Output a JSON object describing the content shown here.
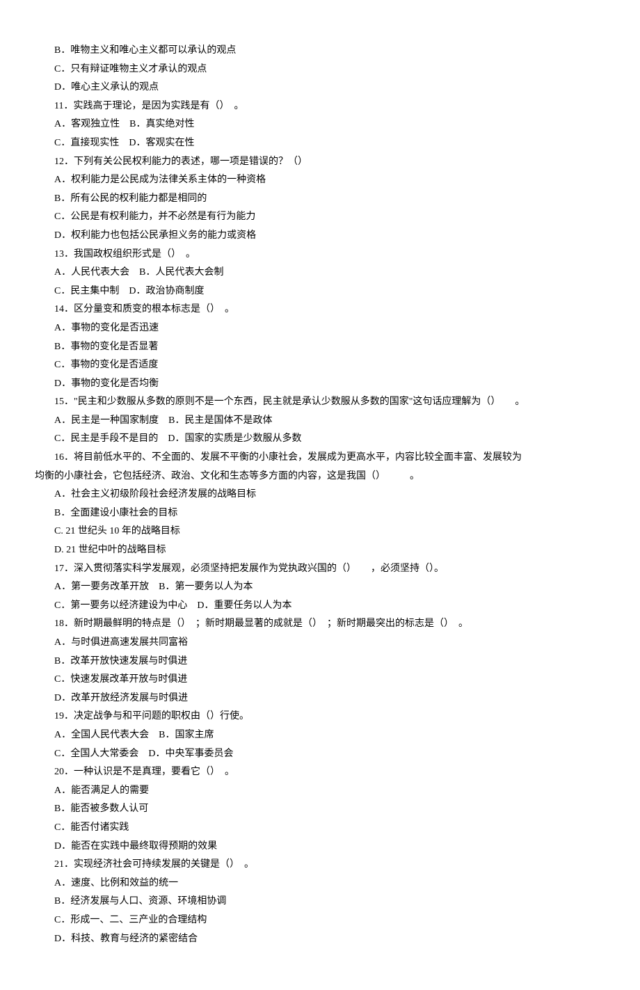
{
  "lines": [
    "B．唯物主义和唯心主义都可以承认的观点",
    "C．只有辩证唯物主义才承认的观点",
    "D．唯心主义承认的观点",
    "11．实践高于理论，是因为实践是有（）　。",
    "A．客观独立性　B．真实绝对性",
    "C．直接现实性　D．客观实在性",
    "12．下列有关公民权利能力的表述，哪一项是错误的？（）",
    "A．权利能力是公民成为法律关系主体的一种资格",
    "B．所有公民的权利能力都是相同的",
    "C．公民是有权利能力，并不必然是有行为能力",
    "D．权利能力也包括公民承担义务的能力或资格",
    "13．我国政权组织形式是（）　。",
    "A．人民代表大会　B．人民代表大会制",
    "C．民主集中制　D．政治协商制度",
    "14．区分量变和质变的根本标志是（）　。",
    "A．事物的变化是否迅速",
    "B．事物的变化是否显著",
    "C．事物的变化是否适度",
    "D．事物的变化是否均衡",
    "15．\"民主和少数服从多数的原则不是一个东西，民主就是承认少数服从多数的国家\"这句话应理解为（）　　。",
    "A．民主是一种国家制度　B．民主是国体不是政体",
    "C．民主是手段不是目的　D．国家的实质是少数服从多数"
  ],
  "q16_line1": "16．将目前低水平的、不全面的、发展不平衡的小康社会，发展成为更高水平，内容比较全面丰富、发展较为",
  "q16_line2": "均衡的小康社会，它包括经济、政治、文化和生态等多方面的内容，这是我国（）　　　。",
  "lines2": [
    "A．社会主义初级阶段社会经济发展的战略目标",
    "B．全面建设小康社会的目标",
    "C. 21 世纪头 10 年的战略目标",
    "D. 21 世纪中叶的战略目标",
    "17．深入贯彻落实科学发展观，必须坚持把发展作为党执政兴国的（）　　，必须坚持（）。",
    "A．第一要务改革开放　B．第一要务以人为本",
    "C．第一要务以经济建设为中心　D．重要任务以人为本",
    "18．新时期最鲜明的特点是（）　；新时期最显著的成就是（）　；新时期最突出的标志是（）　。",
    "A．与时俱进高速发展共同富裕",
    "B．改革开放快速发展与时俱进",
    "C．快速发展改革开放与时俱进",
    "D．改革开放经济发展与时俱进",
    "19．决定战争与和平问题的职权由（）行使。",
    "A．全国人民代表大会　B．国家主席",
    "C．全国人大常委会　D．中央军事委员会",
    "20．一种认识是不是真理，要看它（）　。",
    "A．能否满足人的需要",
    "B．能否被多数人认可",
    "C．能否付诸实践",
    "D．能否在实践中最终取得预期的效果",
    "21．实现经济社会可持续发展的关键是（）　。",
    "A．速度、比例和效益的统一",
    "B．经济发展与人口、资源、环境相协调",
    "C．形成一、二、三产业的合理结构",
    "D．科技、教育与经济的紧密结合"
  ]
}
